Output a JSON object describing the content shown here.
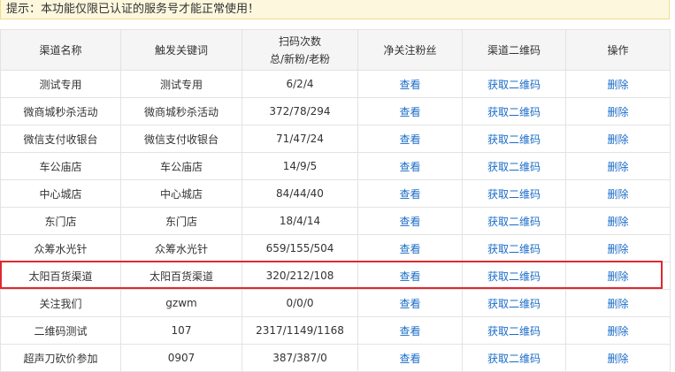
{
  "notice": {
    "text": "提示：本功能仅限已认证的服务号才能正常使用！"
  },
  "table": {
    "headers": {
      "name": "渠道名称",
      "keyword": "触发关键词",
      "scans_line1": "扫码次数",
      "scans_line2": "总/新粉/老粉",
      "net_fans": "净关注粉丝",
      "qrcode": "渠道二维码",
      "action": "操作"
    },
    "view_label": "查看",
    "qrcode_label": "获取二维码",
    "delete_label": "删除",
    "rows": [
      {
        "name": "测试专用",
        "keyword": "测试专用",
        "scans": "6/2/4"
      },
      {
        "name": "微商城秒杀活动",
        "keyword": "微商城秒杀活动",
        "scans": "372/78/294"
      },
      {
        "name": "微信支付收银台",
        "keyword": "微信支付收银台",
        "scans": "71/47/24"
      },
      {
        "name": "车公庙店",
        "keyword": "车公庙店",
        "scans": "14/9/5"
      },
      {
        "name": "中心城店",
        "keyword": "中心城店",
        "scans": "84/44/40"
      },
      {
        "name": "东门店",
        "keyword": "东门店",
        "scans": "18/4/14"
      },
      {
        "name": "众筹水光针",
        "keyword": "众筹水光针",
        "scans": "659/155/504"
      },
      {
        "name": "太阳百货渠道",
        "keyword": "太阳百货渠道",
        "scans": "320/212/108"
      },
      {
        "name": "关注我们",
        "keyword": "gzwm",
        "scans": "0/0/0"
      },
      {
        "name": "二维码测试",
        "keyword": "107",
        "scans": "2317/1149/1168"
      },
      {
        "name": "超声刀砍价参加",
        "keyword": "0907",
        "scans": "387/387/0"
      }
    ]
  },
  "colors": {
    "link": "#1a6cc8",
    "highlight_border": "#e0282f",
    "notice_background": "#fdf7de"
  }
}
